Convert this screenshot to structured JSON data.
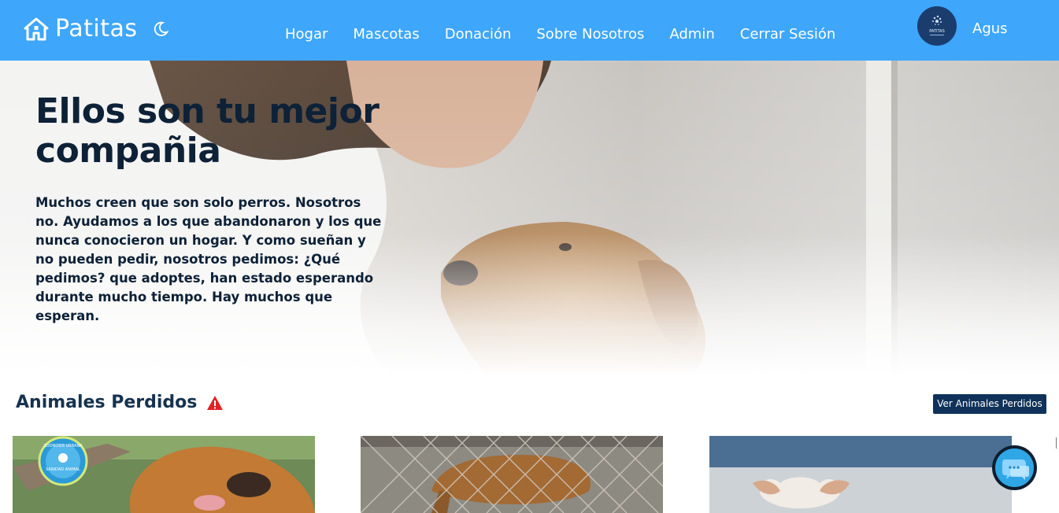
{
  "header": {
    "brand": "Patitas",
    "home_icon": "house-icon",
    "theme_icon": "moon-icon",
    "nav": [
      "Hogar",
      "Mascotas",
      "Donación",
      "Sobre Nosotros",
      "Admin",
      "Cerrar Sesión"
    ],
    "avatar_label": "PATITAS",
    "user_name": "Agus"
  },
  "hero": {
    "title": "Ellos son tu mejor compañia",
    "text": "Muchos creen que son solo perros. Nosotros no. Ayudamos a los que abandonaron y los que nunca conocieron un hogar. Y como sueñan y no pueden pedir, nosotros pedimos: ¿Qué pedimos? que adoptes, han estado esperando durante mucho tiempo. Hay muchos que esperan."
  },
  "lost_section": {
    "title": "Animales Perdidos",
    "icon": "warning-icon",
    "button_label": "Ver Animales Perdidos",
    "cards": [
      {
        "badge_top": "ZOONOSIS URBANA",
        "badge_bottom": "SANIDAD ANIMAL"
      },
      {},
      {}
    ]
  },
  "chat": {
    "icon": "chat-bubble-icon"
  },
  "colors": {
    "navbar": "#3ea6fb",
    "heading": "#0d2137",
    "button": "#10325a",
    "warning": "#e02424"
  }
}
